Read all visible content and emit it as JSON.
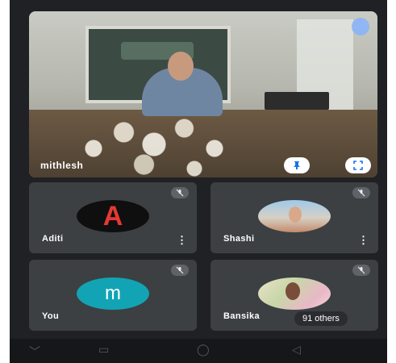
{
  "main_speaker": {
    "name": "mithlesh",
    "pin_icon": "pin-icon",
    "expand_icon": "expand-icon"
  },
  "participants": [
    {
      "name": "Aditi",
      "avatar_letter": "A",
      "muted": true
    },
    {
      "name": "Shashi",
      "muted": true
    },
    {
      "name": "You",
      "avatar_letter": "m",
      "muted": true
    },
    {
      "name": "Bansika",
      "muted": true
    }
  ],
  "others_label": "91 others",
  "colors": {
    "background": "#202124",
    "tile": "#3c4043",
    "you_avatar": "#12a4b4",
    "accent": "#1a73e8"
  },
  "nav_bar": {
    "icons": [
      "chevron-down-icon",
      "recent-apps-icon",
      "home-icon",
      "back-icon"
    ]
  }
}
